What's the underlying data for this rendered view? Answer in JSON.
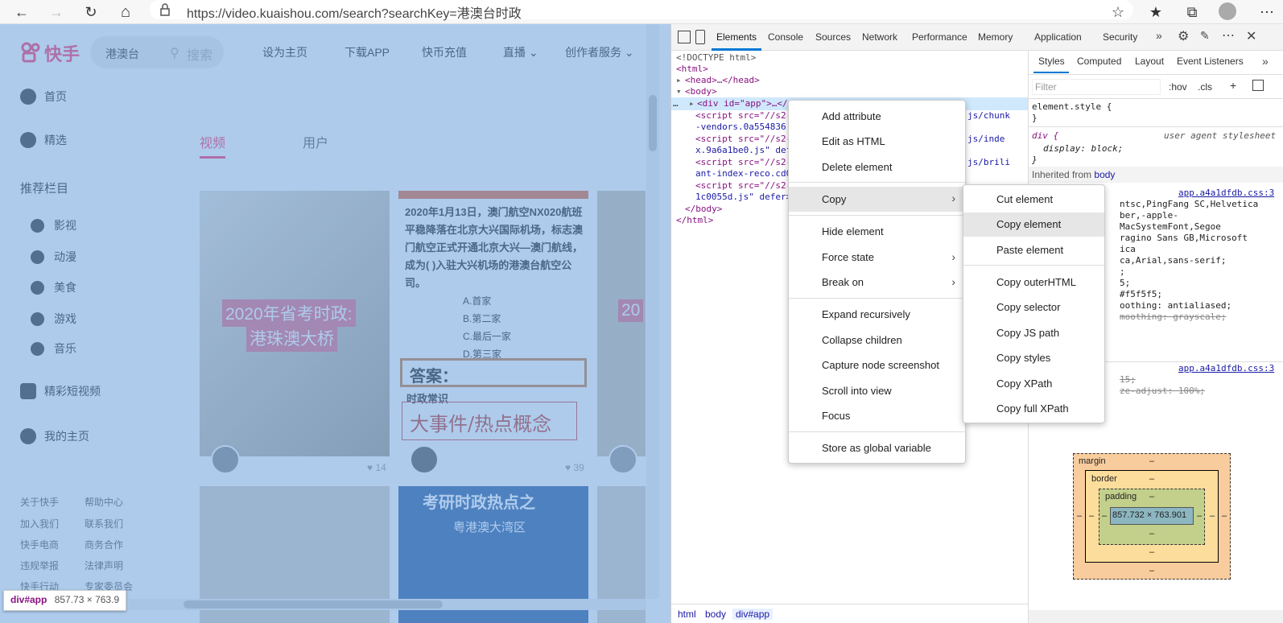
{
  "browser": {
    "url": "https://video.kuaishou.com/search?searchKey=港澳台时政",
    "back_icon": "←",
    "forward_icon": "→",
    "reload_icon": "↻",
    "home_icon": "⌂",
    "lock_icon": "🔒",
    "star_icon": "☆",
    "favorites_icon": "★",
    "collections_icon": "⧉",
    "more_icon": "⋯"
  },
  "page": {
    "logo_text": "快手",
    "search_value": "港澳台",
    "search_placeholder": "搜索",
    "nav": [
      "设为主页",
      "下载APP",
      "快币充值",
      "直播",
      "创作者服务"
    ],
    "sidebar": {
      "home": "首页",
      "featured": "精选",
      "recommend_heading": "推荐栏目",
      "categories": [
        "影视",
        "动漫",
        "美食",
        "游戏",
        "音乐"
      ],
      "short_video": "精彩短视频",
      "my_home": "我的主页"
    },
    "tabs": [
      "视频",
      "用户"
    ],
    "cards": [
      {
        "overlay_text_1": "2020年省考时政:",
        "overlay_text_2": "港珠澳大桥",
        "likes": "14"
      },
      {
        "top_text": "2020年1月13日，澳门航空NX020航班平稳降落在北京大兴国际机场，标志澳门航空正式开通北京大兴—澳门航线，成为(      )入驻大兴机场的港澳台航空公司。",
        "options": [
          "A.首家",
          "B.第二家",
          "C.最后一家",
          "D.第三家"
        ],
        "answer_label": "答案：",
        "section_label": "时政常识",
        "big_text": "大事件/热点概念",
        "likes": "39"
      },
      {
        "overlay_text_1": "20",
        "likes": ""
      },
      {
        "big_text": "考研时政热点之",
        "sub_text": "粤港澳大湾区"
      }
    ],
    "footer_links": [
      "关于快手",
      "帮助中心",
      "加入我们",
      "联系我们",
      "快手电商",
      "商务合作",
      "违规举报",
      "法律声明",
      "快手行动",
      "专家委员会"
    ],
    "inspect_tooltip": {
      "tag": "div#app",
      "size": "857.73 × 763.9"
    }
  },
  "devtools": {
    "tabs": [
      "Elements",
      "Console",
      "Sources",
      "Network",
      "Performance",
      "Memory",
      "Application",
      "Security"
    ],
    "dom_lines": [
      "<!DOCTYPE html>",
      "<html>",
      "<head>…</head>",
      "<body>",
      "<div id=\"app\">…</di",
      "<script src=\"//s2-1",
      "-vendors.0a554836.j",
      "<script src=\"//s2-1",
      "x.9a6a1be0.js\" defe",
      "<script src=\"//s2-1",
      "ant-index-reco.cd0e",
      "<script src=\"//s2-1",
      "1c0055d.js\" defer><",
      "</body>",
      "</html>"
    ],
    "dom_right_fragments": [
      "js/chunk",
      "js/inde",
      "js/brili"
    ],
    "breadcrumbs": [
      "html",
      "body",
      "div#app"
    ],
    "styles": {
      "tabs": [
        "Styles",
        "Computed",
        "Layout",
        "Event Listeners"
      ],
      "filter_placeholder": "Filter",
      "hov": ":hov",
      ".cls": ".cls",
      "element_style": "element.style {",
      "close_brace": "}",
      "div_selector": "div {",
      "user_agent": "user agent stylesheet",
      "display_rule": "display: block;",
      "inherited_from": "Inherited from",
      "inherited_el": "body",
      "source_link": "app.a4a1dfdb.css:3",
      "font_lines": [
        "ntsc,PingFang SC,Helvetica",
        "ber,-apple-",
        "MacSystemFont,Segoe",
        "ragino Sans GB,Microsoft",
        "ica",
        "ca,Arial,sans-serif;",
        ";",
        "5;",
        "#f5f5f5;",
        "oothing: antialiased;",
        "moothing: grayscale;"
      ],
      "source_link_2": "app.a4a1dfdb.css:3",
      "lines_2": [
        "15;",
        "ze-adjust: 100%;"
      ],
      "box_model": {
        "margin": "margin",
        "border": "border",
        "padding": "padding",
        "dash": "–",
        "content": "857.732 × 763.901"
      }
    }
  },
  "context_menu": {
    "items": [
      "Add attribute",
      "Edit as HTML",
      "Delete element",
      "Copy",
      "Hide element",
      "Force state",
      "Break on",
      "Expand recursively",
      "Collapse children",
      "Capture node screenshot",
      "Scroll into view",
      "Focus",
      "Store as global variable"
    ],
    "submenu_copy": [
      "Cut element",
      "Copy element",
      "Paste element",
      "Copy outerHTML",
      "Copy selector",
      "Copy JS path",
      "Copy styles",
      "Copy XPath",
      "Copy full XPath"
    ]
  },
  "colors": {
    "accent": "#0078d4",
    "overlay": "#6ca0dc",
    "kuaishou_orange": "#fe3666"
  }
}
